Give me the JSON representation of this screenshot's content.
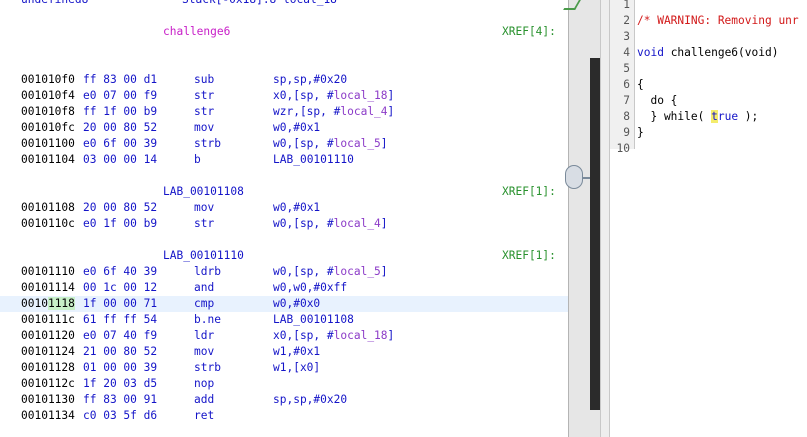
{
  "listing": {
    "top_line": {
      "type": "undefined8",
      "storage": "Stack[-0x18]:8 local_18"
    },
    "function_label": "challenge6",
    "function_xref": "XREF[4]:",
    "blocks": [
      {
        "rows": [
          {
            "addr": "001010f0",
            "bytes": "ff 83 00 d1",
            "mnem": "sub",
            "ops": "sp,sp,#0x20"
          },
          {
            "addr": "001010f4",
            "bytes": "e0 07 00 f9",
            "mnem": "str",
            "ops": "x0,[sp, #local_18]"
          },
          {
            "addr": "001010f8",
            "bytes": "ff 1f 00 b9",
            "mnem": "str",
            "ops": "wzr,[sp, #local_4]"
          },
          {
            "addr": "001010fc",
            "bytes": "20 00 80 52",
            "mnem": "mov",
            "ops": "w0,#0x1"
          },
          {
            "addr": "00101100",
            "bytes": "e0 6f 00 39",
            "mnem": "strb",
            "ops": "w0,[sp, #local_5]"
          },
          {
            "addr": "00101104",
            "bytes": "03 00 00 14",
            "mnem": "b",
            "ops": "LAB_00101110"
          }
        ]
      },
      {
        "label": "LAB_00101108",
        "xref": "XREF[1]:",
        "rows": [
          {
            "addr": "00101108",
            "bytes": "20 00 80 52",
            "mnem": "mov",
            "ops": "w0,#0x1"
          },
          {
            "addr": "0010110c",
            "bytes": "e0 1f 00 b9",
            "mnem": "str",
            "ops": "w0,[sp, #local_4]"
          }
        ]
      },
      {
        "label": "LAB_00101110",
        "xref": "XREF[1]:",
        "rows": [
          {
            "addr": "00101110",
            "bytes": "e0 6f 40 39",
            "mnem": "ldrb",
            "ops": "w0,[sp, #local_5]"
          },
          {
            "addr": "00101114",
            "bytes": "00 1c 00 12",
            "mnem": "and",
            "ops": "w0,w0,#0xff"
          },
          {
            "addr": "00101118",
            "bytes": "1f 00 00 71",
            "mnem": "cmp",
            "ops": "w0,#0x0"
          },
          {
            "addr": "0010111c",
            "bytes": "61 ff ff 54",
            "mnem": "b.ne",
            "ops": "LAB_00101108"
          },
          {
            "addr": "00101120",
            "bytes": "e0 07 40 f9",
            "mnem": "ldr",
            "ops": "x0,[sp, #local_18]"
          },
          {
            "addr": "00101124",
            "bytes": "21 00 80 52",
            "mnem": "mov",
            "ops": "w1,#0x1"
          },
          {
            "addr": "00101128",
            "bytes": "01 00 00 39",
            "mnem": "strb",
            "ops": "w1,[x0]"
          },
          {
            "addr": "0010112c",
            "bytes": "1f 20 03 d5",
            "mnem": "nop",
            "ops": ""
          },
          {
            "addr": "00101130",
            "bytes": "ff 83 00 91",
            "mnem": "add",
            "ops": "sp,sp,#0x20"
          },
          {
            "addr": "00101134",
            "bytes": "c0 03 5f d6",
            "mnem": "ret",
            "ops": ""
          }
        ]
      }
    ],
    "cursor_row_addr_prefix": "0010",
    "cursor_row_addr_hl": "1118"
  },
  "decompiler": {
    "lines": [
      {
        "n": "1",
        "text": ""
      },
      {
        "n": "2",
        "text": "/* WARNING: Removing unr"
      },
      {
        "n": "3",
        "text": ""
      },
      {
        "n": "4",
        "text": "void challenge6(void)"
      },
      {
        "n": "5",
        "text": ""
      },
      {
        "n": "6",
        "text": "{"
      },
      {
        "n": "7",
        "text": "  do {"
      },
      {
        "n": "8",
        "text": "  } while( true );"
      },
      {
        "n": "9",
        "text": "}"
      },
      {
        "n": "10",
        "text": ""
      }
    ]
  },
  "colors": {
    "address_hl": "#c8f0c8",
    "line_hl": "#e8f2fe",
    "func_label": "#c81ec8",
    "xref": "#28912d",
    "ops": "#1414c8"
  }
}
